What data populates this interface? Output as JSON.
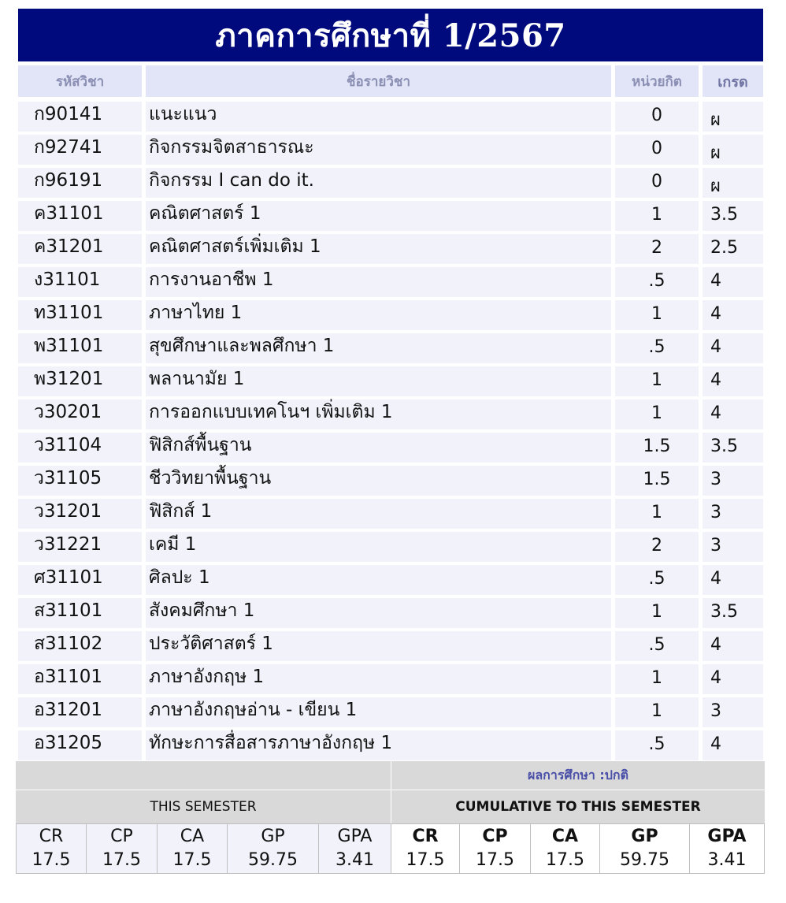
{
  "title": "ภาคการศึกษาที่ 1/2567",
  "headers": {
    "code": "รหัสวิชา",
    "name": "ชื่อรายวิชา",
    "credit": "หน่วยกิต",
    "grade": "เกรด"
  },
  "courses": [
    {
      "code": "ก90141",
      "name": "แนะแนว",
      "credit": "0",
      "grade": "ผ"
    },
    {
      "code": "ก92741",
      "name": "กิจกรรมจิตสาธารณะ",
      "credit": "0",
      "grade": "ผ"
    },
    {
      "code": "ก96191",
      "name": "กิจกรรม I can do it.",
      "credit": "0",
      "grade": "ผ"
    },
    {
      "code": "ค31101",
      "name": "คณิตศาสตร์ 1",
      "credit": "1",
      "grade": "3.5"
    },
    {
      "code": "ค31201",
      "name": "คณิตศาสตร์เพิ่มเติม 1",
      "credit": "2",
      "grade": "2.5"
    },
    {
      "code": "ง31101",
      "name": "การงานอาชีพ 1",
      "credit": ".5",
      "grade": "4"
    },
    {
      "code": "ท31101",
      "name": "ภาษาไทย 1",
      "credit": "1",
      "grade": "4"
    },
    {
      "code": "พ31101",
      "name": "สุขศึกษาและพลศึกษา 1",
      "credit": ".5",
      "grade": "4"
    },
    {
      "code": "พ31201",
      "name": "พลานามัย 1",
      "credit": "1",
      "grade": "4"
    },
    {
      "code": "ว30201",
      "name": "การออกแบบเทคโนฯ เพิ่มเติม 1",
      "credit": "1",
      "grade": "4"
    },
    {
      "code": "ว31104",
      "name": "ฟิสิกส์พื้นฐาน",
      "credit": "1.5",
      "grade": "3.5"
    },
    {
      "code": "ว31105",
      "name": "ชีววิทยาพื้นฐาน",
      "credit": "1.5",
      "grade": "3"
    },
    {
      "code": "ว31201",
      "name": "ฟิสิกส์ 1",
      "credit": "1",
      "grade": "3"
    },
    {
      "code": "ว31221",
      "name": "เคมี 1",
      "credit": "2",
      "grade": "3"
    },
    {
      "code": "ศ31101",
      "name": "ศิลปะ 1",
      "credit": ".5",
      "grade": "4"
    },
    {
      "code": "ส31101",
      "name": "สังคมศึกษา 1",
      "credit": "1",
      "grade": "3.5"
    },
    {
      "code": "ส31102",
      "name": "ประวัติศาสตร์ 1",
      "credit": ".5",
      "grade": "4"
    },
    {
      "code": "อ31101",
      "name": "ภาษาอังกฤษ 1",
      "credit": "1",
      "grade": "4"
    },
    {
      "code": "อ31201",
      "name": "ภาษาอังกฤษอ่าน - เขียน 1",
      "credit": "1",
      "grade": "3"
    },
    {
      "code": "อ31205",
      "name": "ทักษะการสื่อสารภาษาอังกฤษ 1",
      "credit": ".5",
      "grade": "4"
    }
  ],
  "summary": {
    "status": "ผลการศึกษา :ปกติ",
    "this_semester_label": "THIS SEMESTER",
    "cumulative_label": "CUMULATIVE TO THIS SEMESTER",
    "this_semester": [
      {
        "k": "CR",
        "v": "17.5"
      },
      {
        "k": "CP",
        "v": "17.5"
      },
      {
        "k": "CA",
        "v": "17.5"
      },
      {
        "k": "GP",
        "v": "59.75"
      },
      {
        "k": "GPA",
        "v": "3.41"
      }
    ],
    "cumulative": [
      {
        "k": "CR",
        "v": "17.5"
      },
      {
        "k": "CP",
        "v": "17.5"
      },
      {
        "k": "CA",
        "v": "17.5"
      },
      {
        "k": "GP",
        "v": "59.75"
      },
      {
        "k": "GPA",
        "v": "3.41"
      }
    ]
  }
}
